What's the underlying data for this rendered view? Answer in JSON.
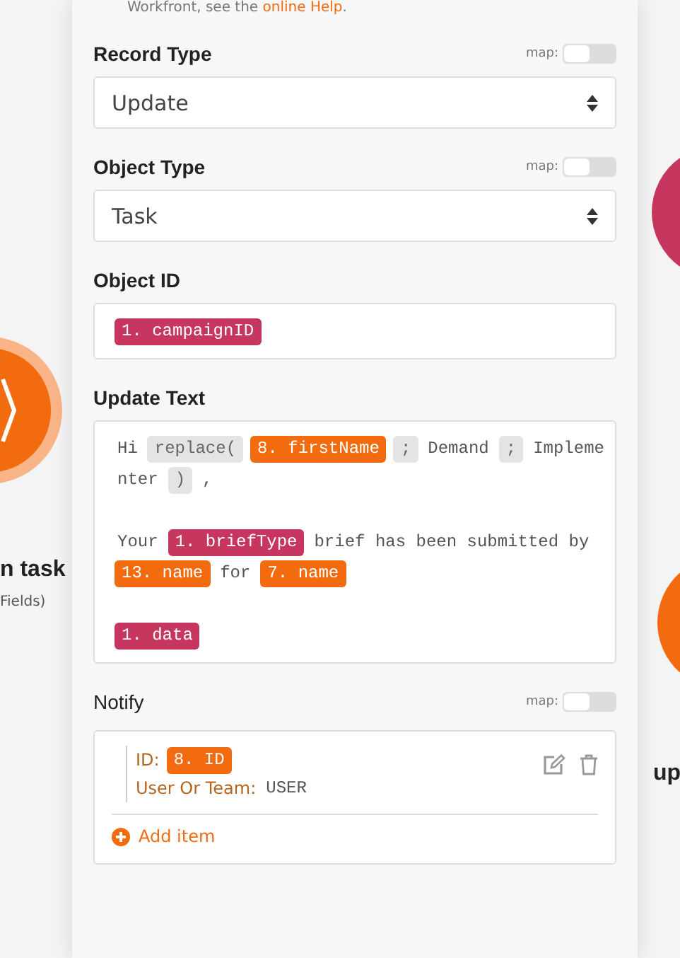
{
  "help": {
    "text": "Workfront, see the ",
    "link": "online Help",
    "end": "."
  },
  "canvas": {
    "modules": [
      {
        "title": "n task",
        "subtitle": "Fields)",
        "color": "#f26b0f"
      },
      {
        "color": "#c7365f"
      },
      {
        "title": "up",
        "color": "#f26b0f"
      }
    ]
  },
  "fields": [
    {
      "kind": "select",
      "label": "Record Type",
      "required": true,
      "map": {
        "label": "map:",
        "on": false
      },
      "value": "Update"
    },
    {
      "kind": "select",
      "label": "Object Type",
      "required": true,
      "map": {
        "label": "map:",
        "on": false
      },
      "value": "Task"
    },
    {
      "kind": "tokens",
      "label": "Object ID",
      "required": true,
      "paragraphs": [
        [
          [
            {
              "kind": "var",
              "text": "1. campaignID",
              "color": "#c7365f"
            }
          ]
        ]
      ]
    },
    {
      "kind": "tokens",
      "label": "Update Text",
      "required": true,
      "paragraphs": [
        [
          [
            {
              "kind": "text",
              "text": "Hi"
            },
            {
              "kind": "func",
              "text": "replace("
            },
            {
              "kind": "var",
              "text": "8. firstName",
              "color": "#f26b0f"
            },
            {
              "kind": "func",
              "text": ";"
            },
            {
              "kind": "text",
              "text": "Demand"
            },
            {
              "kind": "func",
              "text": ";"
            },
            {
              "kind": "text",
              "text": "Impleme"
            }
          ],
          [
            {
              "kind": "text",
              "text": "nter"
            },
            {
              "kind": "func",
              "text": ")"
            },
            {
              "kind": "text",
              "text": ","
            }
          ]
        ],
        [
          [
            {
              "kind": "text",
              "text": "Your"
            },
            {
              "kind": "var",
              "text": "1. briefType",
              "color": "#c7365f"
            },
            {
              "kind": "text",
              "text": "brief has been submitted by"
            }
          ],
          [
            {
              "kind": "var",
              "text": "13. name",
              "color": "#f26b0f"
            },
            {
              "kind": "text",
              "text": "for"
            },
            {
              "kind": "var",
              "text": "7. name",
              "color": "#f26b0f"
            }
          ]
        ],
        [
          [
            {
              "kind": "var",
              "text": "1. data",
              "color": "#c7365f"
            }
          ]
        ]
      ]
    },
    {
      "kind": "list",
      "label": "Notify",
      "required": false,
      "map": {
        "label": "map:",
        "on": false
      },
      "add_label": "Add item",
      "items": [
        {
          "fields": [
            {
              "label": "ID:",
              "value": {
                "kind": "var",
                "text": "8. ID",
                "color": "#f26b0f"
              }
            },
            {
              "label": "User Or Team:",
              "value": {
                "kind": "text",
                "text": "USER"
              }
            }
          ]
        }
      ]
    }
  ]
}
